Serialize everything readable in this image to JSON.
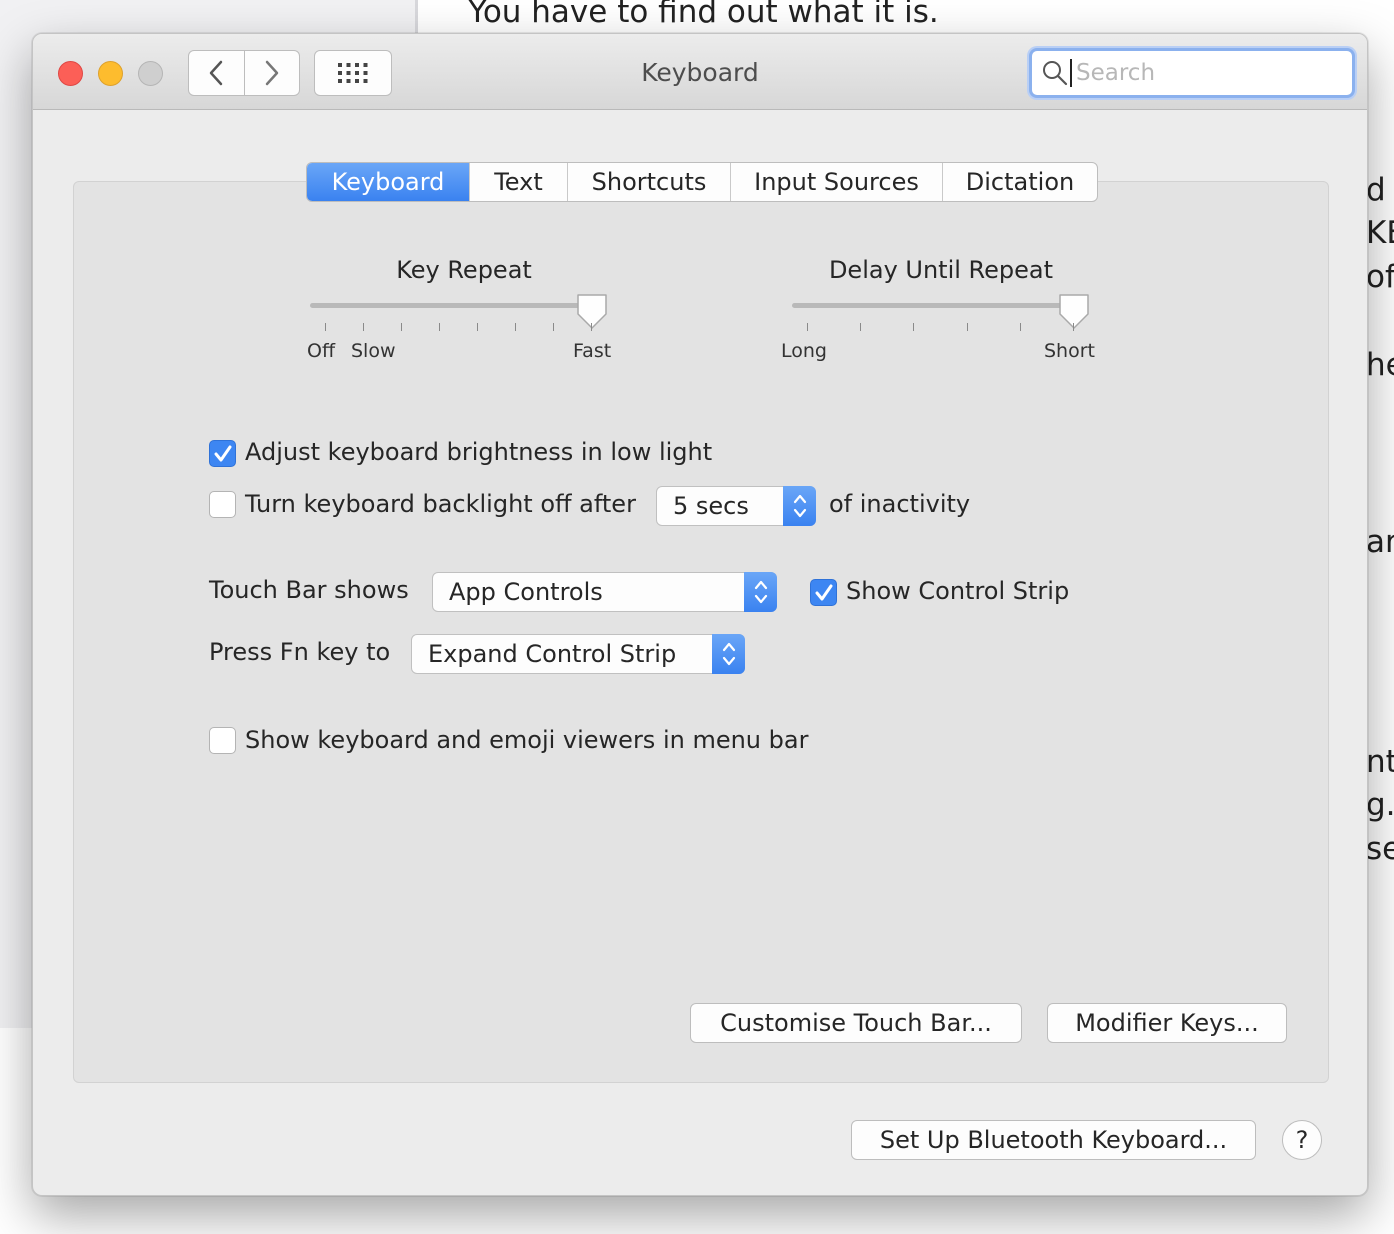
{
  "background": {
    "doc_line": "You have to find out what it is.",
    "right_fragments": [
      "d",
      "KE",
      "of",
      "he",
      "ar",
      "nt",
      "g.",
      "se"
    ]
  },
  "window": {
    "title": "Keyboard",
    "search_placeholder": "Search",
    "nav": {
      "back_icon": "chevron-left-icon",
      "forward_icon": "chevron-right-icon",
      "grid_icon": "grid-icon"
    }
  },
  "tabs": [
    {
      "label": "Keyboard",
      "active": true
    },
    {
      "label": "Text",
      "active": false
    },
    {
      "label": "Shortcuts",
      "active": false
    },
    {
      "label": "Input Sources",
      "active": false
    },
    {
      "label": "Dictation",
      "active": false
    }
  ],
  "key_repeat": {
    "title": "Key Repeat",
    "label_off": "Off",
    "label_slow": "Slow",
    "label_fast": "Fast",
    "tick_count": 8,
    "value": 1.0
  },
  "delay_until_repeat": {
    "title": "Delay Until Repeat",
    "label_long": "Long",
    "label_short": "Short",
    "tick_count": 6,
    "value": 1.0
  },
  "options": {
    "adjust_brightness": {
      "label": "Adjust keyboard brightness in low light",
      "checked": true
    },
    "backlight_off": {
      "label": "Turn keyboard backlight off after",
      "checked": false,
      "value": "5 secs",
      "suffix": "of inactivity"
    },
    "touch_bar_shows": {
      "label": "Touch Bar shows",
      "value": "App Controls"
    },
    "show_control_strip": {
      "label": "Show Control Strip",
      "checked": true
    },
    "press_fn_key": {
      "label": "Press Fn key to",
      "value": "Expand Control Strip"
    },
    "show_viewers": {
      "label": "Show keyboard and emoji viewers in menu bar",
      "checked": false
    }
  },
  "buttons": {
    "customise_touch_bar": "Customise Touch Bar...",
    "modifier_keys": "Modifier Keys...",
    "bluetooth_keyboard": "Set Up Bluetooth Keyboard...",
    "help": "?"
  },
  "colors": {
    "accent": "#3d86f2",
    "close": "#fc5f57",
    "minimize": "#fdbc2e",
    "zoom_disabled": "#cfcfcf"
  }
}
